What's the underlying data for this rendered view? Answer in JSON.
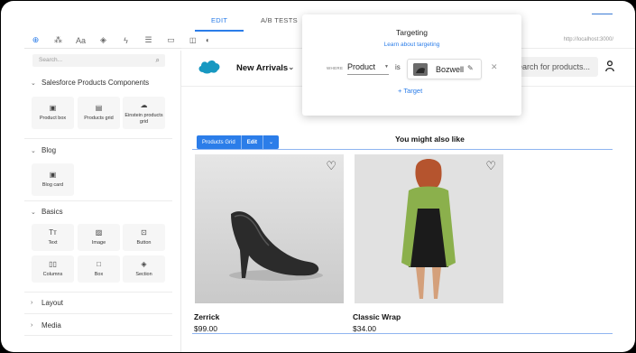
{
  "editor": {
    "tabs": [
      "EDIT",
      "A/B TESTS"
    ],
    "url": "http://localhost:3000/",
    "tools": [
      "plus-icon",
      "puzzle-icon",
      "text-style-icon",
      "layers-icon",
      "bolt-icon",
      "database-icon",
      "comment-icon"
    ]
  },
  "left_panel": {
    "search_placeholder": "Search...",
    "sections": [
      {
        "title": "Salesforce Products Components",
        "items": [
          {
            "label": "Product box",
            "icon": "box-icon"
          },
          {
            "label": "Products grid",
            "icon": "grid-icon"
          },
          {
            "label": "Einstein products grid",
            "icon": "einstein-icon"
          }
        ]
      },
      {
        "title": "Blog",
        "items": [
          {
            "label": "Blog card",
            "icon": "card-icon"
          }
        ]
      },
      {
        "title": "Basics",
        "items": [
          {
            "label": "Text",
            "icon": "text-icon"
          },
          {
            "label": "Image",
            "icon": "image-icon"
          },
          {
            "label": "Button",
            "icon": "button-icon"
          },
          {
            "label": "Columns",
            "icon": "columns-icon"
          },
          {
            "label": "Box",
            "icon": "square-icon"
          },
          {
            "label": "Section",
            "icon": "section-icon"
          }
        ]
      },
      {
        "title": "Layout"
      },
      {
        "title": "Media"
      }
    ]
  },
  "store": {
    "nav_title": "New Arrivals",
    "search_placeholder": "Search for products...",
    "section_title": "You might also like",
    "grid_toolbar": {
      "label": "Products Grid",
      "edit": "Edit"
    },
    "products": [
      {
        "name": "Zerrick",
        "price": "$99.00"
      },
      {
        "name": "Classic Wrap",
        "price": "$34.00"
      }
    ]
  },
  "targeting": {
    "title": "Targeting",
    "link": "Learn about targeting",
    "where_label": "WHERE",
    "field": "Product",
    "operator": "is",
    "value": "Bozwell",
    "add_label": "+ Target"
  },
  "colors": {
    "accent": "#2b7de9"
  }
}
